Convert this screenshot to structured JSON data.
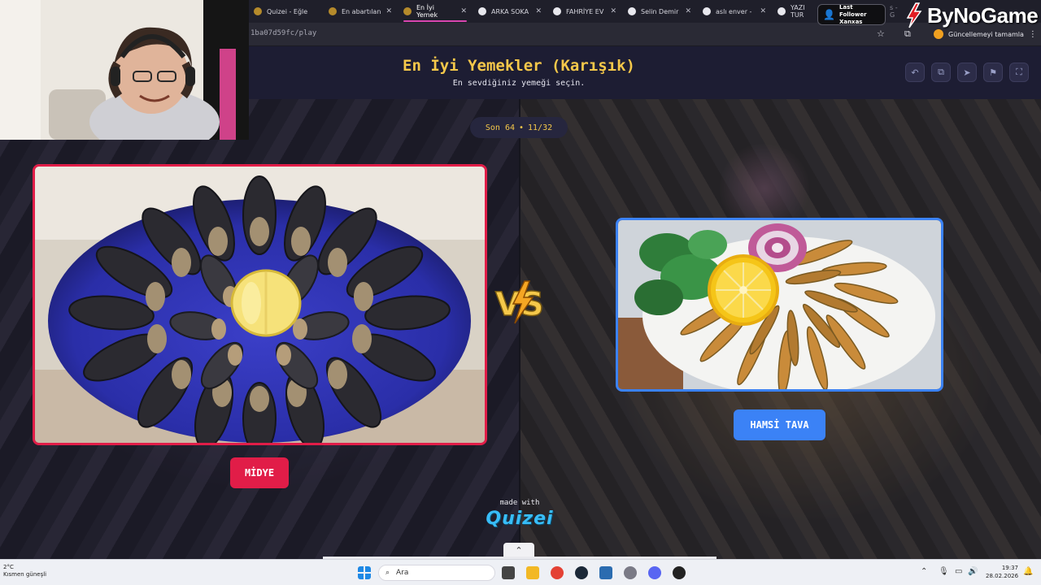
{
  "browser": {
    "tabs": [
      {
        "label": "Quizei - Eğle",
        "active": false
      },
      {
        "label": "En abartılan",
        "active": false
      },
      {
        "label": "En İyi Yemek",
        "active": true
      },
      {
        "label": "ARKA SOKA",
        "active": false
      },
      {
        "label": "FAHRİYE EV",
        "active": false
      },
      {
        "label": "Selin Demir",
        "active": false
      },
      {
        "label": "aslı enver - ",
        "active": false
      },
      {
        "label": "YAZI TUR",
        "active": false
      }
    ],
    "tab_overflow_text": "s - G",
    "url": "1ba07d59fc/play",
    "update_label": "Güncellemeyi tamamla",
    "colors": {
      "active_tab_underline": "#d946b0"
    }
  },
  "quiz": {
    "title": "En İyi Yemekler (Karışık)",
    "subtitle": "En sevdiğiniz yemeği seçin.",
    "round": {
      "stage": "Son 64",
      "separator": "•",
      "progress": "11/32"
    },
    "header_buttons": [
      "undo-icon",
      "share-icon",
      "send-icon",
      "flag-icon",
      "fullscreen-icon"
    ],
    "left_choice": {
      "label": "MİDYE",
      "color": "#e11d48"
    },
    "right_choice": {
      "label": "HAMSİ TAVA",
      "color": "#3b82f6"
    },
    "vs_label": "VS",
    "made_with": "made with",
    "brand": "Quizei"
  },
  "overlay": {
    "follower_title": "Last Follower",
    "follower_name": "Xanxas",
    "channel_brand": "ByNoGame"
  },
  "taskbar": {
    "search_placeholder": "Ara",
    "weather_temp": "2°C",
    "weather_desc": "Kısmen güneşli",
    "time": "19:37",
    "date": "28.02.2026"
  }
}
